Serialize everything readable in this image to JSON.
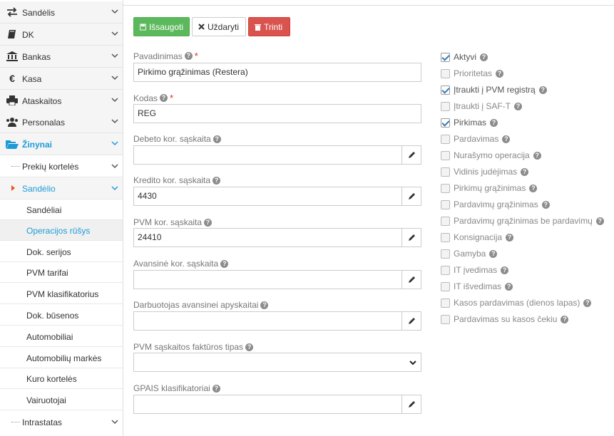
{
  "sidebar": {
    "nav": [
      {
        "label": "Sandėlis",
        "icon": "exchange-icon"
      },
      {
        "label": "DK",
        "icon": "book-icon"
      },
      {
        "label": "Bankas",
        "icon": "bank-icon"
      },
      {
        "label": "Kasa",
        "icon": "euro-icon"
      },
      {
        "label": "Ataskaitos",
        "icon": "print-icon"
      },
      {
        "label": "Personalas",
        "icon": "users-icon"
      },
      {
        "label": "Žinynai",
        "icon": "folder-open-icon"
      }
    ],
    "sub": [
      {
        "label": "Prekių kortelės"
      },
      {
        "label": "Sandėlio"
      }
    ],
    "leaves": [
      {
        "label": "Sandėliai"
      },
      {
        "label": "Operacijos rūšys"
      },
      {
        "label": "Dok. serijos"
      },
      {
        "label": "PVM tarifai"
      },
      {
        "label": "PVM klasifikatorius"
      },
      {
        "label": "Dok. būsenos"
      },
      {
        "label": "Automobiliai"
      },
      {
        "label": "Automobilių markės"
      },
      {
        "label": "Kuro kortelės"
      },
      {
        "label": "Vairuotojai"
      }
    ],
    "bottom": {
      "label": "Intrastatas"
    }
  },
  "toolbar": {
    "save_label": "Išsaugoti",
    "close_label": "Uždaryti",
    "delete_label": "Trinti"
  },
  "form": {
    "name": {
      "label": "Pavadinimas",
      "value": "Pirkimo grąžinimas (Restera)"
    },
    "code": {
      "label": "Kodas",
      "value": "REG"
    },
    "debit": {
      "label": "Debeto kor. sąskaita",
      "value": ""
    },
    "credit": {
      "label": "Kredito kor. sąskaita",
      "value": "4430"
    },
    "vat": {
      "label": "PVM kor. sąskaita",
      "value": "24410"
    },
    "advance": {
      "label": "Avansinė kor. sąskaita",
      "value": ""
    },
    "employee": {
      "label": "Darbuotojas avansinei apyskaitai",
      "value": ""
    },
    "invoice_type": {
      "label": "PVM sąskaitos faktūros tipas",
      "value": ""
    },
    "gpais": {
      "label": "GPAIS klasifikatoriai",
      "value": ""
    }
  },
  "checkboxes": [
    {
      "label": "Aktyvi",
      "checked": true
    },
    {
      "label": "Prioritetas",
      "checked": false
    },
    {
      "label": "Įtraukti į PVM registrą",
      "checked": true
    },
    {
      "label": "Įtraukti į SAF-T",
      "checked": false
    },
    {
      "label": "Pirkimas",
      "checked": true
    },
    {
      "label": "Pardavimas",
      "checked": false
    },
    {
      "label": "Nurašymo operacija",
      "checked": false
    },
    {
      "label": "Vidinis judėjimas",
      "checked": false
    },
    {
      "label": "Pirkimų grąžinimas",
      "checked": false
    },
    {
      "label": "Pardavimų grąžinimas",
      "checked": false
    },
    {
      "label": "Pardavimų grąžinimas be pardavimų",
      "checked": false
    },
    {
      "label": "Konsignacija",
      "checked": false
    },
    {
      "label": "Gamyba",
      "checked": false
    },
    {
      "label": "IT įvedimas",
      "checked": false
    },
    {
      "label": "IT išvedimas",
      "checked": false
    },
    {
      "label": "Kasos pardavimas (dienos lapas)",
      "checked": false
    },
    {
      "label": "Pardavimas su kasos čekiu",
      "checked": false
    }
  ],
  "colors": {
    "accent": "#1e9bd7",
    "save": "#5cb85c",
    "delete": "#d9534f"
  }
}
